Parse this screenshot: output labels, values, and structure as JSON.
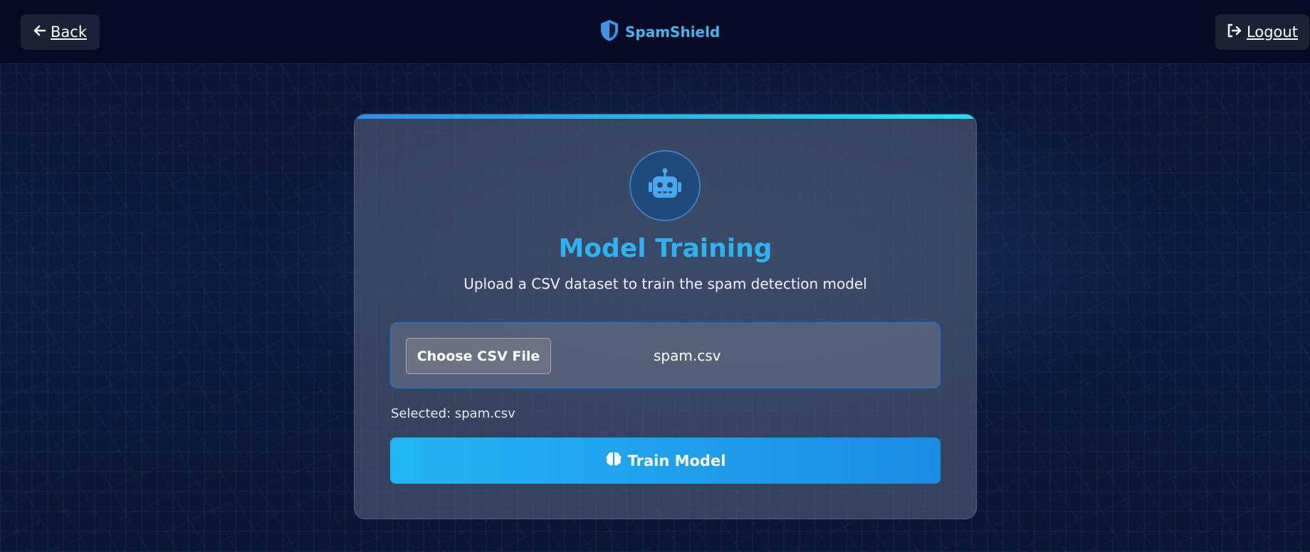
{
  "header": {
    "back_label": "Back",
    "brand_name": "SpamShield",
    "logout_label": "Logout"
  },
  "card": {
    "icon": "robot-icon",
    "title": "Model Training",
    "subtitle": "Upload a CSV dataset to train the spam detection model",
    "file_input": {
      "button_label": "Choose CSV File",
      "file_name": "spam.csv"
    },
    "selected_text": "Selected: spam.csv",
    "train_button": {
      "icon": "brain-icon",
      "label": "Train Model"
    }
  },
  "colors": {
    "accent": "#2fb3f0",
    "brand": "#4ab3ef",
    "button_gradient_start": "#22b5f4",
    "button_gradient_end": "#1b8ce4",
    "header_bg": "#050b22"
  }
}
